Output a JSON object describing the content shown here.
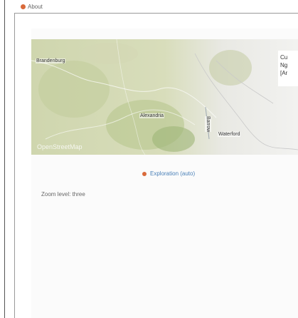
{
  "header": {
    "about_label": "About",
    "icon": "about-dot-icon"
  },
  "map": {
    "labels": [
      "Brandenburg",
      "Alexandria",
      "Barrow",
      "Waterford"
    ],
    "attribution": "OpenStreetMap",
    "legend_lines": [
      "Cu",
      "Ng",
      "[Ar"
    ]
  },
  "section": {
    "link_label": "Exploration (auto)",
    "caption": "Zoom level: three"
  },
  "colors": {
    "accent": "#d96a3b",
    "link": "#4a80b8",
    "map_bg": "#e6e2c8"
  }
}
